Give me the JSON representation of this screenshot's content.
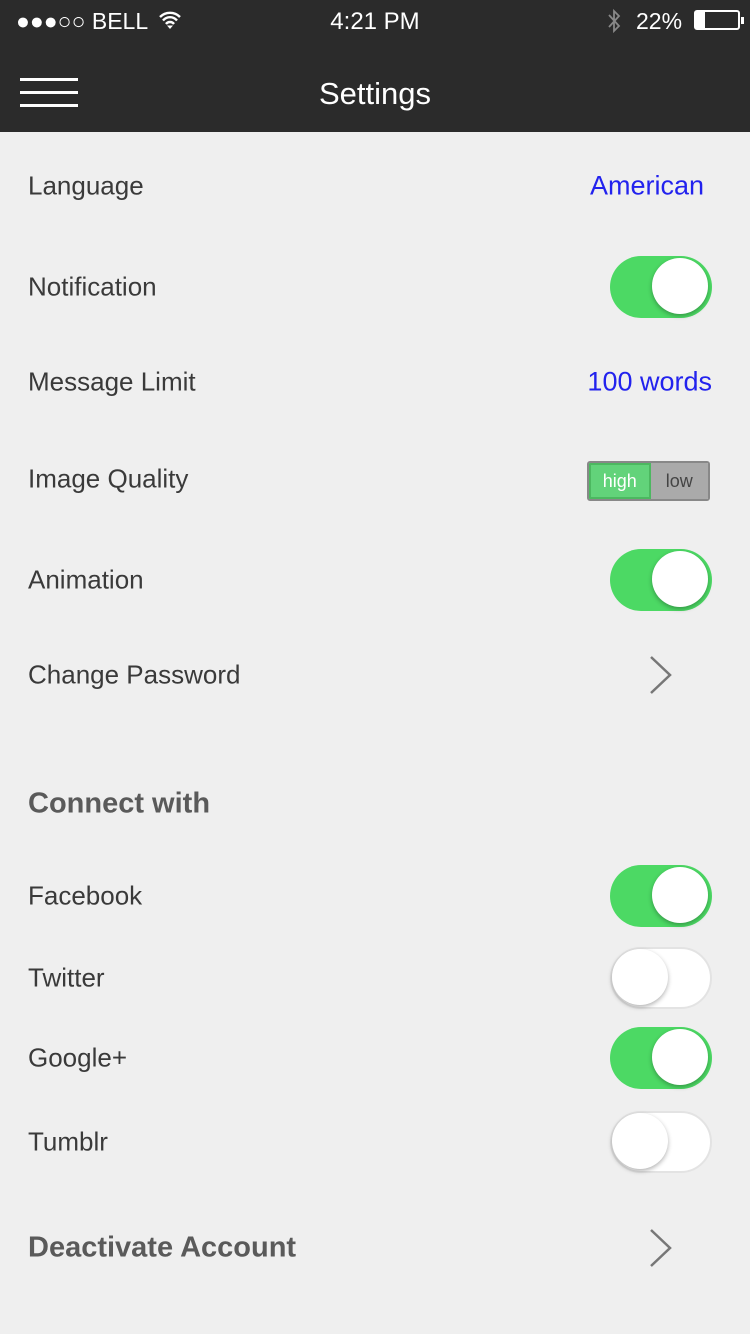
{
  "status_bar": {
    "carrier": "●●●○○ BELL",
    "time": "4:21 PM",
    "battery": "22%",
    "battery_level": 0.22
  },
  "header": {
    "title": "Settings"
  },
  "settings": {
    "language": {
      "label": "Language",
      "value": "American"
    },
    "notification": {
      "label": "Notification",
      "on": true
    },
    "message_limit": {
      "label": "Message Limit",
      "value": "100 words"
    },
    "image_quality": {
      "label": "Image Quality",
      "options": [
        "high",
        "low"
      ],
      "selected": "high"
    },
    "animation": {
      "label": "Animation",
      "on": true
    },
    "change_password": {
      "label": "Change Password"
    }
  },
  "connect": {
    "heading": "Connect with",
    "items": [
      {
        "label": "Facebook",
        "on": true
      },
      {
        "label": "Twitter",
        "on": false
      },
      {
        "label": "Google+",
        "on": true
      },
      {
        "label": "Tumblr",
        "on": false
      }
    ]
  },
  "deactivate": {
    "label": "Deactivate Account"
  },
  "colors": {
    "accent": "#4cd964",
    "link": "#2222ee",
    "bar": "#2b2b2b"
  }
}
